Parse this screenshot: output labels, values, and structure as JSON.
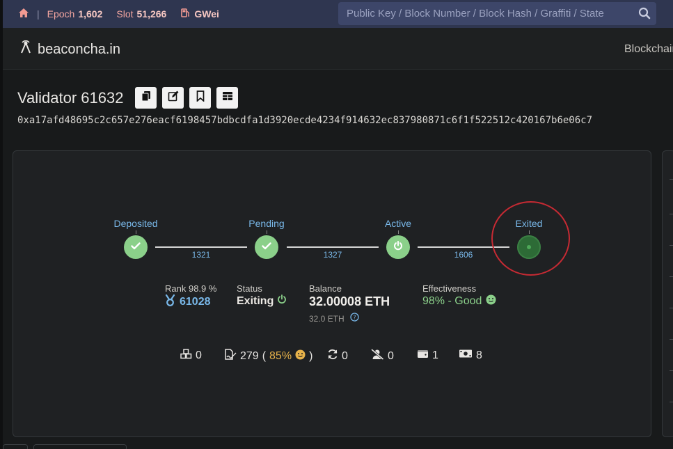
{
  "topbar": {
    "home_icon": "home-icon",
    "epoch_label": "Epoch",
    "epoch_value": "1,602",
    "slot_label": "Slot",
    "slot_value": "51,266",
    "gas_icon": "gas-pump-icon",
    "gas_label": "GWei",
    "search_placeholder": "Public Key / Block Number / Block Hash / Graffiti / State"
  },
  "nav": {
    "brand": "beaconcha.in",
    "right_item": "Blockchain"
  },
  "validator": {
    "title": "Validator 61632",
    "pubkey": "0xa17afd48695c2c657e276eacf6198457bdbcdfa1d3920ecde4234f914632ec837980871c6f1f522512c420167b6e06c7"
  },
  "lifecycle": {
    "stages": [
      {
        "label": "Deposited",
        "icon": "check-icon"
      },
      {
        "label": "Pending",
        "icon": "check-icon"
      },
      {
        "label": "Active",
        "icon": "power-icon"
      },
      {
        "label": "Exited",
        "icon": "dot-icon"
      }
    ],
    "connectors": [
      "1321",
      "1327",
      "1606"
    ]
  },
  "stats": {
    "rank_label": "Rank 98.9 %",
    "rank_value": "61028",
    "status_label": "Status",
    "status_value": "Exiting",
    "balance_label": "Balance",
    "balance_value": "32.00008 ETH",
    "balance_sub": "32.0 ETH",
    "effectiveness_label": "Effectiveness",
    "effectiveness_value": "98% - Good"
  },
  "counters": {
    "proposals": "0",
    "attestations": "279",
    "attestations_pct": "85%",
    "sync": "0",
    "slashings": "0",
    "deposits": "1",
    "withdrawals": "8"
  },
  "colors": {
    "accent_blue": "#79b8e9",
    "success_green": "#8bd08a",
    "highlight_red": "#c62a33",
    "topbar_bg": "#2f3650"
  }
}
